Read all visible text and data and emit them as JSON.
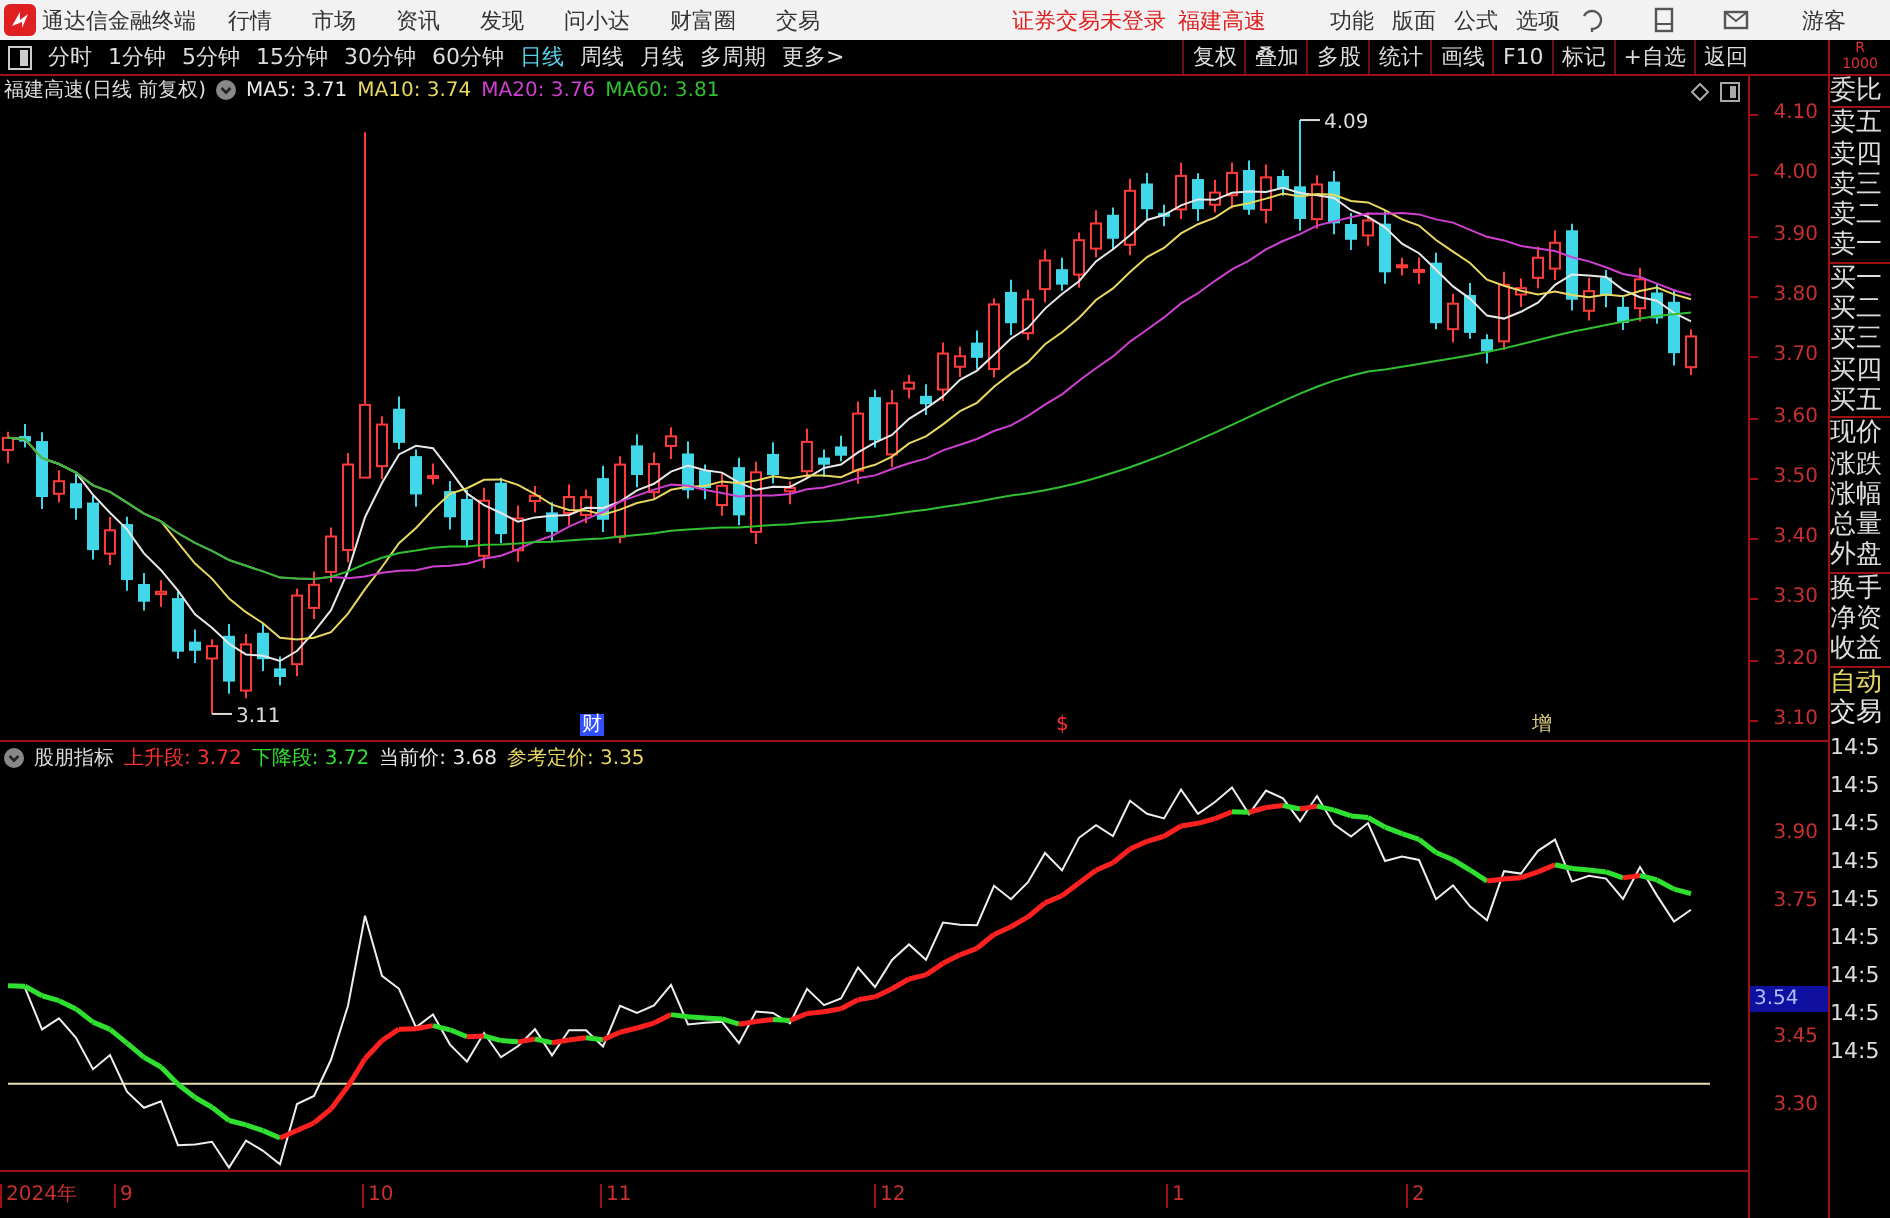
{
  "menu_bar": {
    "app_title": "通达信金融终端",
    "menus": [
      "行情",
      "市场",
      "资讯",
      "发现",
      "问小达",
      "财富圈",
      "交易"
    ],
    "login_notice": "证券交易未登录",
    "stock_name": "福建高速",
    "tools": [
      "功能",
      "版面",
      "公式",
      "选项"
    ],
    "user": "游客"
  },
  "period_tabs": [
    {
      "label": "分时",
      "selected": false
    },
    {
      "label": "1分钟",
      "selected": false
    },
    {
      "label": "5分钟",
      "selected": false
    },
    {
      "label": "15分钟",
      "selected": false
    },
    {
      "label": "30分钟",
      "selected": false
    },
    {
      "label": "60分钟",
      "selected": false
    },
    {
      "label": "日线",
      "selected": true
    },
    {
      "label": "周线",
      "selected": false
    },
    {
      "label": "月线",
      "selected": false
    },
    {
      "label": "多周期",
      "selected": false
    },
    {
      "label": "更多>",
      "selected": false
    }
  ],
  "toolbar_buttons": [
    "复权",
    "叠加",
    "多股",
    "统计",
    "画线",
    "F10",
    "标记",
    "+自选",
    "返回"
  ],
  "main_chart": {
    "title": "福建高速(日线 前复权)",
    "ma_labels": [
      {
        "text": "MA5: 3.71",
        "color": "#e8e8e8"
      },
      {
        "text": "MA10: 3.74",
        "color": "#e8d860"
      },
      {
        "text": "MA20: 3.76",
        "color": "#d040d0"
      },
      {
        "text": "MA60: 3.81",
        "color": "#30c030"
      }
    ],
    "high_label": "4.09",
    "low_label": "3.11",
    "event_marks": [
      {
        "text": "财",
        "color": "#3050ff"
      },
      {
        "text": "$",
        "color": "#ff3030"
      },
      {
        "text": "增",
        "color": "#e0d080"
      }
    ],
    "price_axis": [
      "4.10",
      "4.00",
      "3.90",
      "3.80",
      "3.70",
      "3.60",
      "3.50",
      "3.40",
      "3.30",
      "3.20",
      "3.10"
    ]
  },
  "indicator": {
    "name": "股朋指标",
    "readings": [
      {
        "text": "上升段: 3.72",
        "color": "#ff3030"
      },
      {
        "text": "下降段: 3.72",
        "color": "#30e030"
      },
      {
        "text": "当前价: 3.68",
        "color": "#e8e8e8"
      },
      {
        "text": "参考定价: 3.35",
        "color": "#e8d860"
      }
    ],
    "axis": [
      "3.90",
      "3.75",
      "3.45",
      "3.30"
    ],
    "current_marker": "3.54"
  },
  "date_axis": [
    "2024年",
    "9",
    "10",
    "11",
    "12",
    "1",
    "2"
  ],
  "side_panel": {
    "corner": "R",
    "corner_sub": "1000",
    "quote_labels": [
      "委比",
      "卖五",
      "卖四",
      "卖三",
      "卖二",
      "卖一",
      "买一",
      "买二",
      "买三",
      "买四",
      "买五",
      "现价",
      "涨跌",
      "涨幅",
      "总量",
      "外盘",
      "换手",
      "净资",
      "收益"
    ],
    "mode_labels": [
      {
        "text": "自动",
        "color": "#e8d860"
      },
      {
        "text": "交易",
        "color": "#e8e8e8"
      }
    ],
    "times": [
      "14:5",
      "14:5",
      "14:5",
      "14:5",
      "14:5",
      "14:5",
      "14:5",
      "14:5",
      "14:5"
    ]
  }
}
